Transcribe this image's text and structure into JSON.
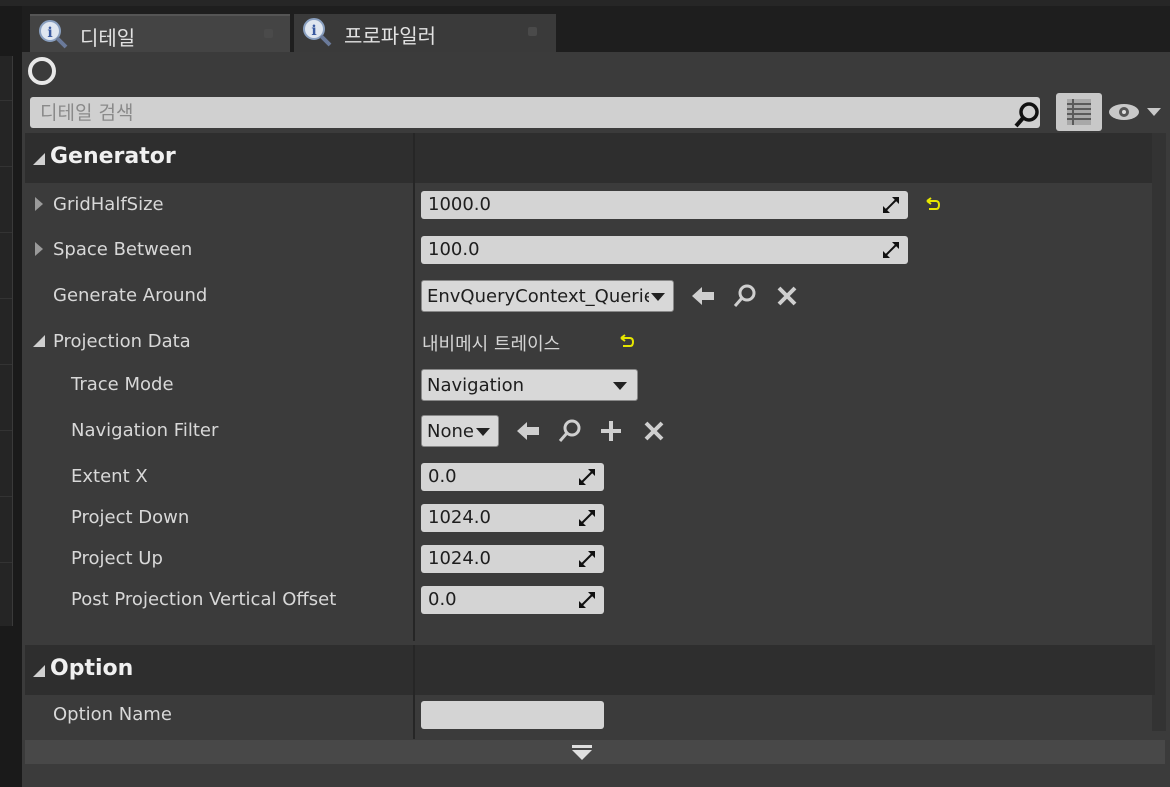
{
  "tabs": [
    {
      "label": "디테일",
      "icon": "details-magnifier-icon"
    },
    {
      "label": "프로파일러",
      "icon": "profiler-magnifier-icon"
    }
  ],
  "search": {
    "placeholder": "디테일 검색"
  },
  "sections": {
    "generator": {
      "title": "Generator",
      "grid_half_size": {
        "label": "GridHalfSize",
        "value": "1000.0"
      },
      "space_between": {
        "label": "Space Between",
        "value": "100.0"
      },
      "generate_around": {
        "label": "Generate Around",
        "value": "EnvQueryContext_Querier"
      },
      "projection_data": {
        "label": "Projection Data",
        "value": "내비메시 트레이스"
      },
      "trace_mode": {
        "label": "Trace Mode",
        "value": "Navigation"
      },
      "navigation_filter": {
        "label": "Navigation Filter",
        "value": "None"
      },
      "extent_x": {
        "label": "Extent X",
        "value": "0.0"
      },
      "project_down": {
        "label": "Project Down",
        "value": "1024.0"
      },
      "project_up": {
        "label": "Project Up",
        "value": "1024.0"
      },
      "post_projection_offset": {
        "label": "Post Projection Vertical Offset",
        "value": "0.0"
      }
    },
    "option": {
      "title": "Option",
      "option_name": {
        "label": "Option Name",
        "value": ""
      }
    }
  },
  "colors": {
    "panel": "#3b3b3b",
    "header": "#2e2e2e",
    "field": "#d4d4d4",
    "reset_arrow": "#e6e600"
  }
}
